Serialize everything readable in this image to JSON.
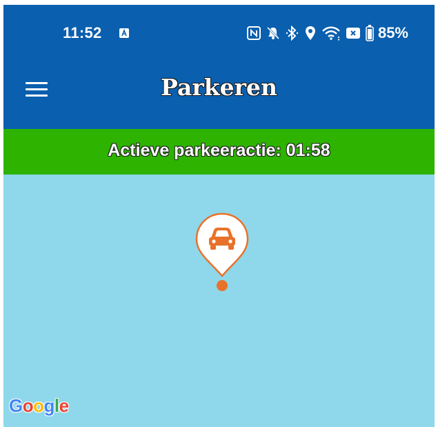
{
  "status_bar": {
    "time": "11:52",
    "battery_percent": "85%",
    "icons": [
      "nfc-icon",
      "mute-icon",
      "bluetooth-icon",
      "location-icon",
      "wifi-icon",
      "x-badge-icon",
      "battery-icon"
    ]
  },
  "app_bar": {
    "title": "Parkeren",
    "menu_icon": "hamburger-menu-icon"
  },
  "banner": {
    "text": "Actieve parkeeractie: 01:58",
    "color": "#2db300"
  },
  "map": {
    "background_color": "#8fd7ea",
    "marker_icon": "car-icon",
    "marker_color": "#e8722a",
    "attribution": {
      "letters": [
        "G",
        "o",
        "o",
        "g",
        "l",
        "e"
      ],
      "colors": [
        "#4285F4",
        "#EA4335",
        "#FBBC05",
        "#4285F4",
        "#34A853",
        "#EA4335"
      ]
    }
  },
  "colors": {
    "app_bar": "#0a5fae",
    "text": "#ffffff"
  }
}
